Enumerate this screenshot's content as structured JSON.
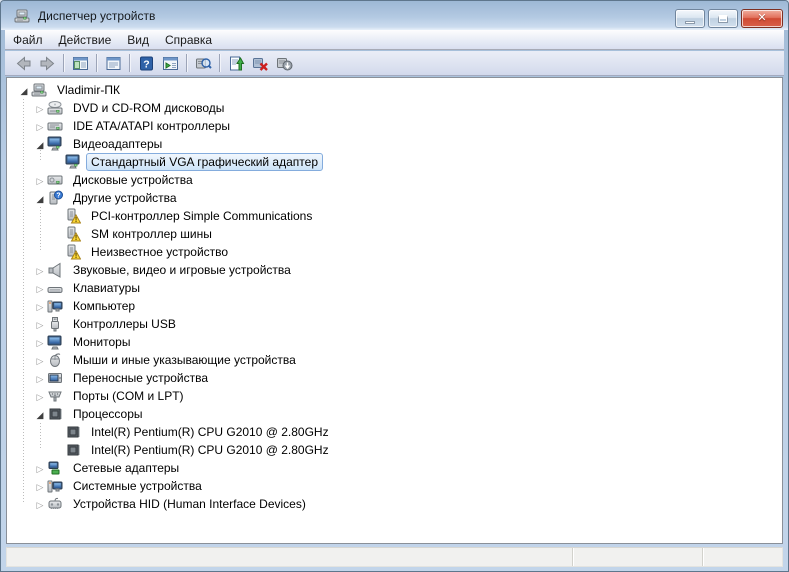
{
  "window": {
    "title": "Диспетчер устройств",
    "controls": [
      {
        "name": "minimize-button",
        "icon": "minimize-icon"
      },
      {
        "name": "maximize-button",
        "icon": "maximize-icon"
      },
      {
        "name": "close-button",
        "icon": "close-icon"
      }
    ]
  },
  "menu": {
    "items": [
      {
        "label": "Файл"
      },
      {
        "label": "Действие"
      },
      {
        "label": "Вид"
      },
      {
        "label": "Справка"
      }
    ]
  },
  "toolbar": {
    "buttons": [
      {
        "name": "back",
        "icon": "arrow-left-icon"
      },
      {
        "name": "forward",
        "icon": "arrow-right-icon"
      },
      {
        "name": "show-console-tree",
        "icon": "console-tree-icon"
      },
      {
        "name": "properties",
        "icon": "properties-icon"
      },
      {
        "name": "help",
        "icon": "help-icon"
      },
      {
        "name": "show-action-pane",
        "icon": "action-pane-icon"
      },
      {
        "name": "search-devices",
        "icon": "device-magnifier-icon"
      },
      {
        "name": "update-driver",
        "icon": "update-driver-icon"
      },
      {
        "name": "uninstall-device",
        "icon": "uninstall-device-icon"
      },
      {
        "name": "scan-hardware-changes",
        "icon": "scan-hardware-icon"
      }
    ]
  },
  "tree": {
    "items": [
      {
        "label": "Vladimir-ПК",
        "level": 0,
        "state": "expanded",
        "icon": "computer-icon",
        "selected": false
      },
      {
        "label": "DVD и CD-ROM дисководы",
        "level": 1,
        "state": "collapsed",
        "icon": "dvd-drive-icon",
        "selected": false
      },
      {
        "label": "IDE ATA/ATAPI контроллеры",
        "level": 1,
        "state": "collapsed",
        "icon": "ide-controller-icon",
        "selected": false
      },
      {
        "label": "Видеоадаптеры",
        "level": 1,
        "state": "expanded",
        "icon": "video-adapter-icon",
        "selected": false
      },
      {
        "label": "Стандартный VGA графический адаптер",
        "level": 2,
        "state": "leaf",
        "icon": "video-adapter-icon",
        "selected": true
      },
      {
        "label": "Дисковые устройства",
        "level": 1,
        "state": "collapsed",
        "icon": "disk-drive-icon",
        "selected": false
      },
      {
        "label": "Другие устройства",
        "level": 1,
        "state": "expanded",
        "icon": "unknown-device-question-icon",
        "selected": false
      },
      {
        "label": "PCI-контроллер Simple Communications",
        "level": 2,
        "state": "leaf",
        "icon": "device-warning-icon",
        "selected": false
      },
      {
        "label": "SM контроллер шины",
        "level": 2,
        "state": "leaf",
        "icon": "device-warning-icon",
        "selected": false
      },
      {
        "label": "Неизвестное устройство",
        "level": 2,
        "state": "leaf",
        "icon": "device-warning-icon",
        "selected": false
      },
      {
        "label": "Звуковые, видео и игровые устройства",
        "level": 1,
        "state": "collapsed",
        "icon": "speaker-icon",
        "selected": false
      },
      {
        "label": "Клавиатуры",
        "level": 1,
        "state": "collapsed",
        "icon": "keyboard-icon",
        "selected": false
      },
      {
        "label": "Компьютер",
        "level": 1,
        "state": "collapsed",
        "icon": "computer-small-icon",
        "selected": false
      },
      {
        "label": "Контроллеры USB",
        "level": 1,
        "state": "collapsed",
        "icon": "usb-icon",
        "selected": false
      },
      {
        "label": "Мониторы",
        "level": 1,
        "state": "collapsed",
        "icon": "monitor-icon",
        "selected": false
      },
      {
        "label": "Мыши и иные указывающие устройства",
        "level": 1,
        "state": "collapsed",
        "icon": "mouse-icon",
        "selected": false
      },
      {
        "label": "Переносные устройства",
        "level": 1,
        "state": "collapsed",
        "icon": "portable-device-icon",
        "selected": false
      },
      {
        "label": "Порты (COM и LPT)",
        "level": 1,
        "state": "collapsed",
        "icon": "port-icon",
        "selected": false
      },
      {
        "label": "Процессоры",
        "level": 1,
        "state": "expanded",
        "icon": "cpu-icon",
        "selected": false
      },
      {
        "label": "Intel(R) Pentium(R) CPU G2010 @ 2.80GHz",
        "level": 2,
        "state": "leaf",
        "icon": "cpu-icon",
        "selected": false
      },
      {
        "label": "Intel(R) Pentium(R) CPU G2010 @ 2.80GHz",
        "level": 2,
        "state": "leaf",
        "icon": "cpu-icon",
        "selected": false
      },
      {
        "label": "Сетевые адаптеры",
        "level": 1,
        "state": "collapsed",
        "icon": "network-adapter-icon",
        "selected": false
      },
      {
        "label": "Системные устройства",
        "level": 1,
        "state": "collapsed",
        "icon": "system-device-icon",
        "selected": false
      },
      {
        "label": "Устройства HID (Human Interface Devices)",
        "level": 1,
        "state": "collapsed",
        "icon": "hid-device-icon",
        "selected": false
      }
    ]
  },
  "statusbar": {
    "panes": 3
  },
  "colors": {
    "titlebar_top": "#9db8d5",
    "titlebar_bottom": "#ccdcef",
    "selection_fill": "#cde3f8",
    "selection_border": "#84acdd",
    "warning_yellow": "#fdd835",
    "question_blue": "#3a7bd5",
    "close_button_red": "#cf4a33",
    "tree_background": "#ffffff",
    "statusbar_background": "#f1f1ef"
  }
}
